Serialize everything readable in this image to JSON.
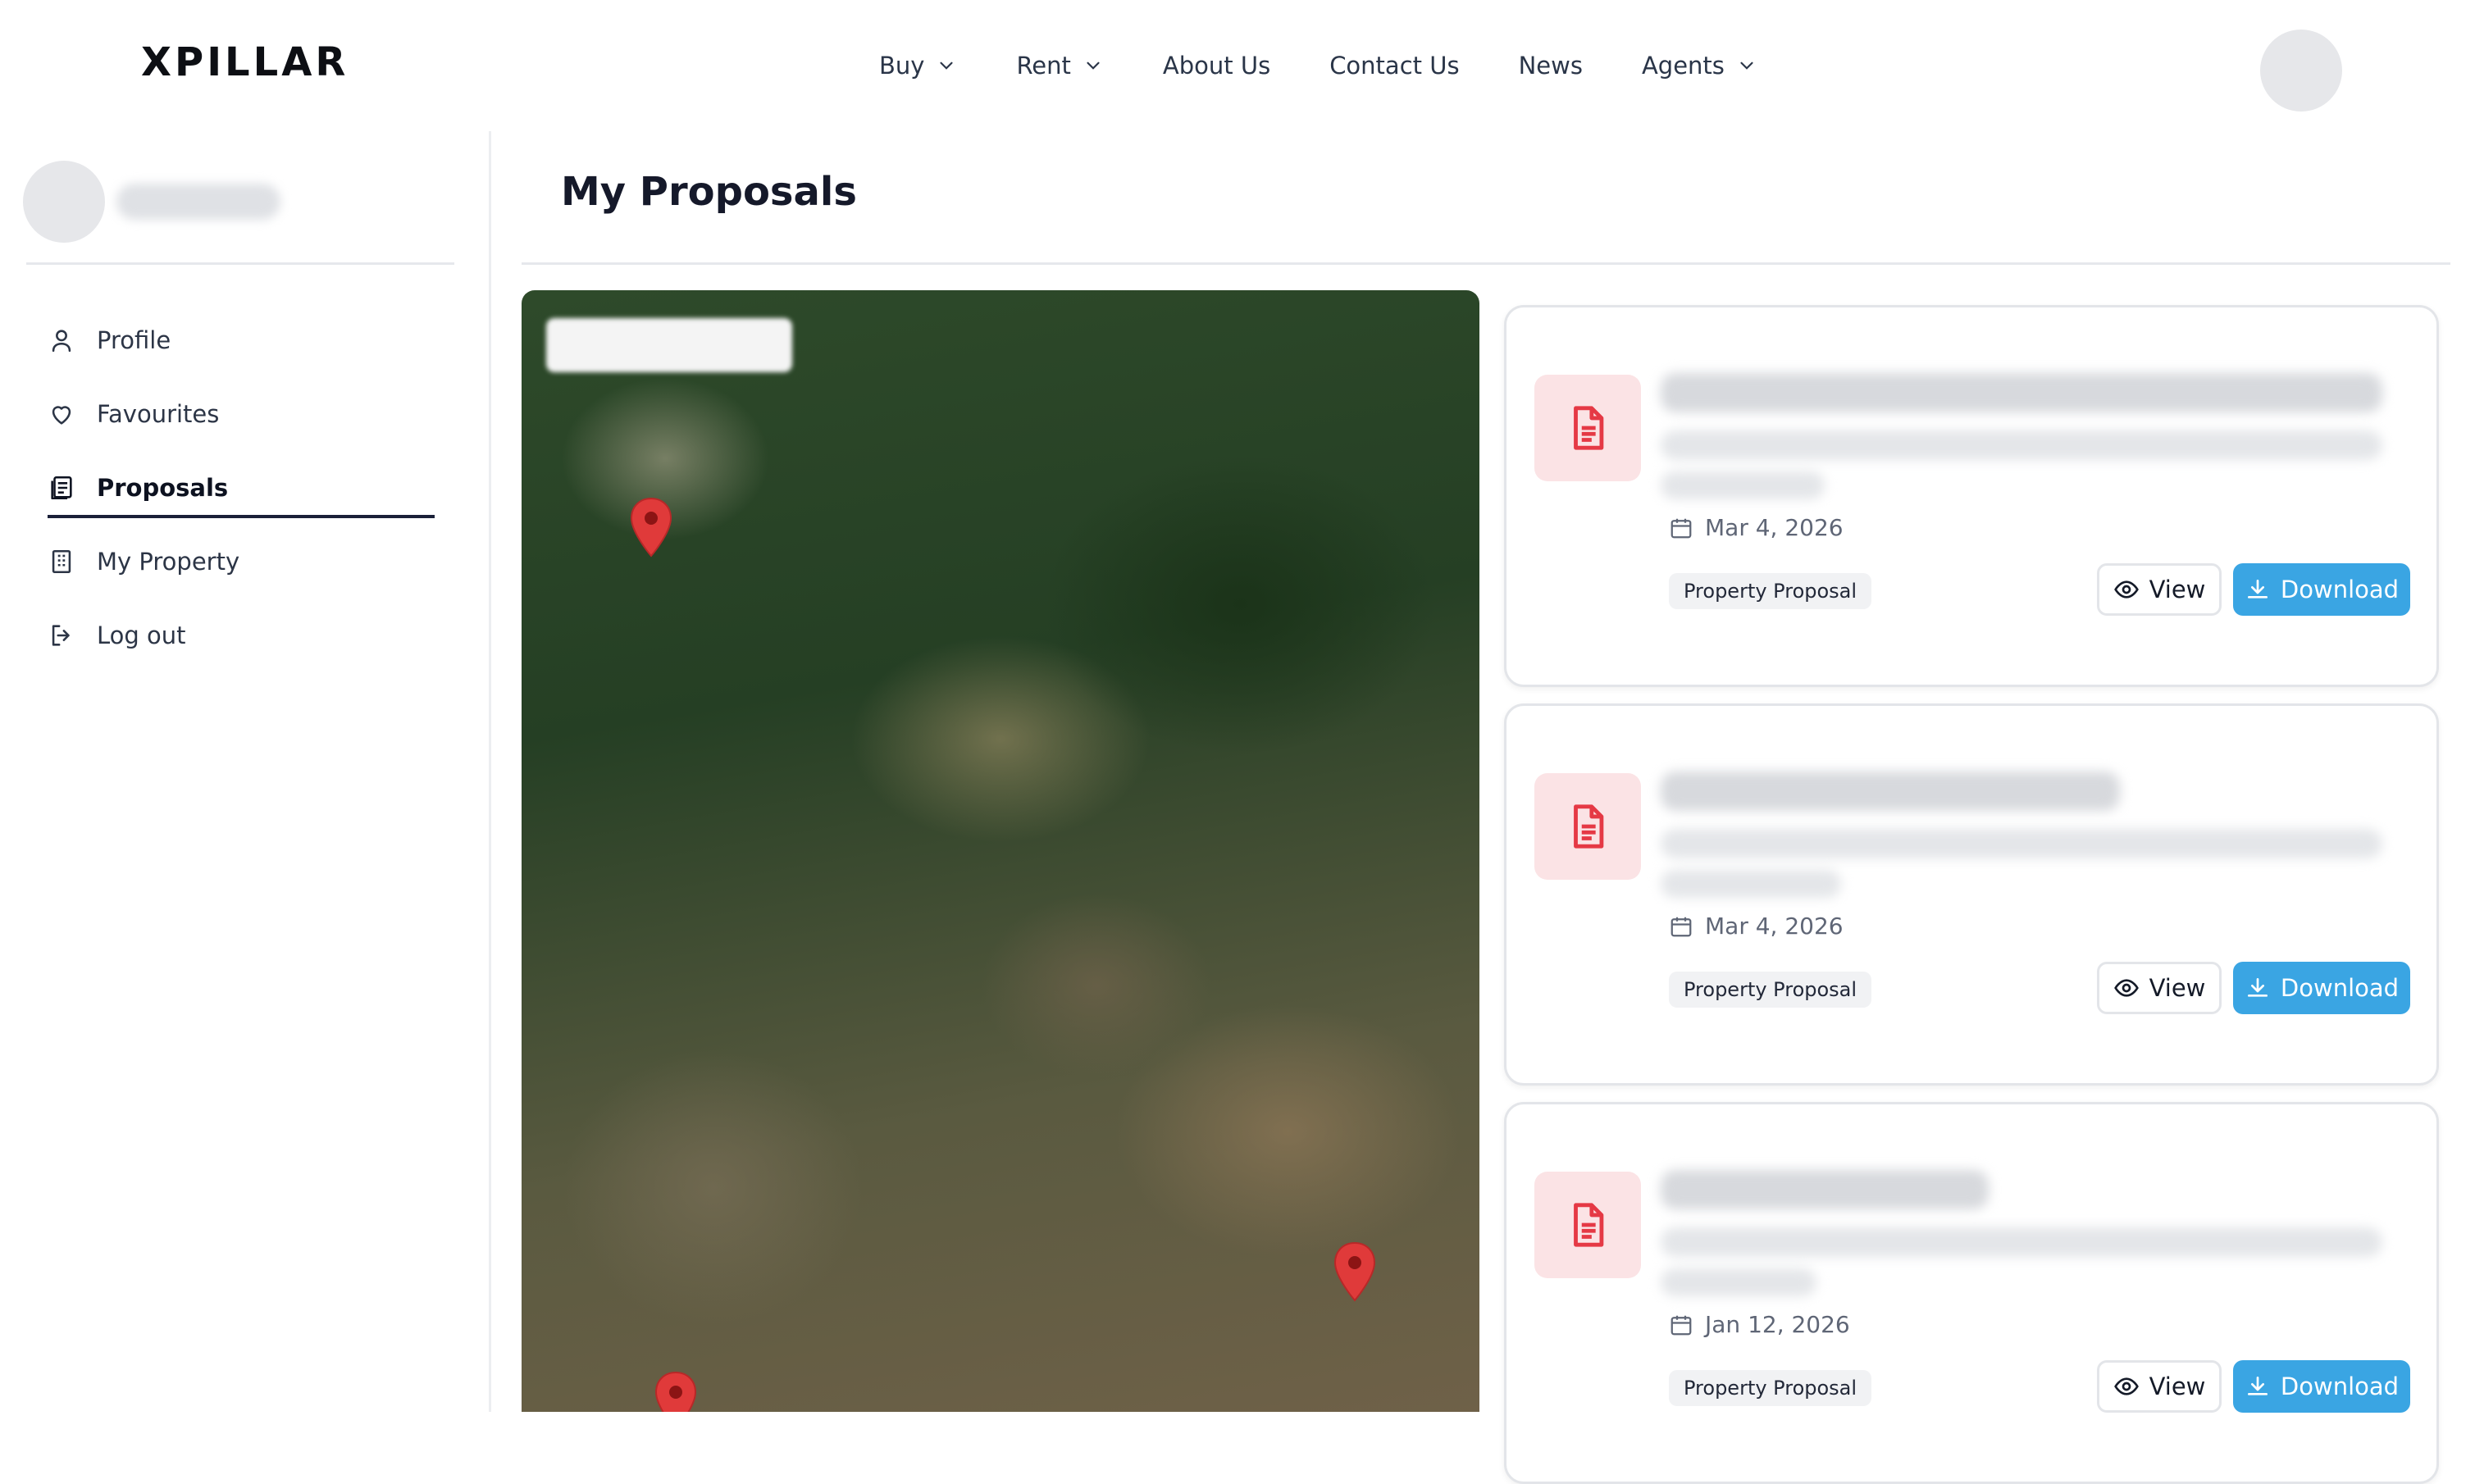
{
  "brand": {
    "logo_text": "XPILLAR"
  },
  "nav": {
    "items": [
      {
        "label": "Buy",
        "has_dropdown": true
      },
      {
        "label": "Rent",
        "has_dropdown": true
      },
      {
        "label": "About Us",
        "has_dropdown": false
      },
      {
        "label": "Contact Us",
        "has_dropdown": false
      },
      {
        "label": "News",
        "has_dropdown": false
      },
      {
        "label": "Agents",
        "has_dropdown": true
      }
    ]
  },
  "sidebar": {
    "items": [
      {
        "label": "Profile",
        "icon": "user-icon",
        "active": false
      },
      {
        "label": "Favourites",
        "icon": "heart-icon",
        "active": false
      },
      {
        "label": "Proposals",
        "icon": "proposals-icon",
        "active": true
      },
      {
        "label": "My Property",
        "icon": "building-icon",
        "active": false
      },
      {
        "label": "Log out",
        "icon": "logout-icon",
        "active": false
      }
    ]
  },
  "main": {
    "title": "My Proposals",
    "proposals": [
      {
        "date": "Mar 4, 2026",
        "tag": "Property Proposal",
        "view_label": "View",
        "download_label": "Download"
      },
      {
        "date": "Mar 4, 2026",
        "tag": "Property Proposal",
        "view_label": "View",
        "download_label": "Download"
      },
      {
        "date": "Jan 12, 2026",
        "tag": "Property Proposal",
        "view_label": "View",
        "download_label": "Download"
      }
    ]
  },
  "colors": {
    "accent": "#3aa5e3",
    "doc_icon": "#e53945",
    "doc_icon_bg": "#fbe3e5",
    "pin": "#e03a3a"
  }
}
